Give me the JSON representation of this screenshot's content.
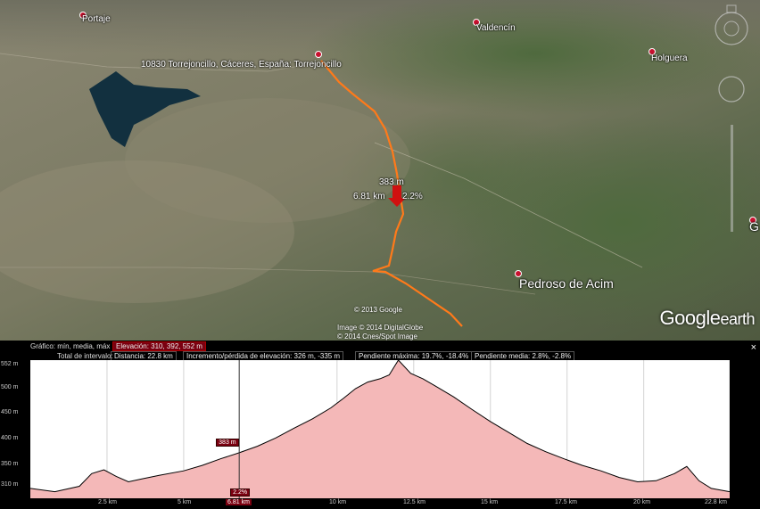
{
  "map": {
    "places": [
      {
        "name": "Portaje"
      },
      {
        "name": "Valdencín"
      },
      {
        "name": "Holguera"
      },
      {
        "name": "10830 Torrejoncillo, Cáceres, España: Torrejoncillo"
      },
      {
        "name": "Pedroso de Acim"
      },
      {
        "name": "G"
      }
    ],
    "route_marker": {
      "elevation": "383 m",
      "distance": "6.81 km",
      "grade": "2.2%"
    },
    "credits": [
      "© 2013 Google",
      "Image © 2014 DigitalGlobe",
      "© 2014 Cnes/Spot Image"
    ],
    "logo": {
      "brand": "Google",
      "product": "earth"
    },
    "close": "×"
  },
  "profile": {
    "header": {
      "graph_label": "Gráfico: mín, media, máx",
      "elevation": "Elevación: 310, 392, 552 m",
      "total_label": "Total de intervalo:",
      "distance": "Distancia: 22.8 km",
      "gain_loss": "Incremento/pérdida de elevación: 326 m, -335 m",
      "max_slope": "Pendiente máxima: 19.7%, -18.4%",
      "avg_slope": "Pendiente media: 2.8%, -2.8%"
    },
    "y_labels": [
      "552 m",
      "500 m",
      "450 m",
      "400 m",
      "350 m",
      "310 m"
    ],
    "x_labels": [
      "2.5 km",
      "5 km",
      "6.81 km",
      "10 km",
      "12.5 km",
      "15 km",
      "17.5 km",
      "20 km",
      "22.8 km"
    ],
    "cursor": {
      "elevation": "383 m",
      "grade": "2.2%",
      "distance_km": 6.81
    },
    "fill_color": "#f4b8b8",
    "line_color": "#000000",
    "accent": "#7a0010"
  },
  "chart_data": {
    "type": "area",
    "xlabel": "",
    "ylabel": "",
    "xlim": [
      0,
      22.8
    ],
    "ylim": [
      300,
      552
    ],
    "x": [
      0,
      0.8,
      1.6,
      2.0,
      2.4,
      2.8,
      3.2,
      3.6,
      4.2,
      5.0,
      5.6,
      6.2,
      6.81,
      7.4,
      8.0,
      8.6,
      9.2,
      9.8,
      10.2,
      10.6,
      11.0,
      11.4,
      11.7,
      12.0,
      12.4,
      12.8,
      13.2,
      13.8,
      14.4,
      15.0,
      15.6,
      16.2,
      16.8,
      17.4,
      18.0,
      18.6,
      19.2,
      19.8,
      20.4,
      21.0,
      21.4,
      21.8,
      22.2,
      22.8
    ],
    "y": [
      318,
      312,
      322,
      345,
      352,
      340,
      330,
      335,
      342,
      350,
      360,
      372,
      383,
      395,
      410,
      428,
      445,
      465,
      482,
      500,
      512,
      518,
      525,
      552,
      528,
      518,
      505,
      485,
      462,
      440,
      420,
      400,
      385,
      372,
      360,
      350,
      338,
      330,
      332,
      345,
      358,
      332,
      318,
      312
    ]
  }
}
